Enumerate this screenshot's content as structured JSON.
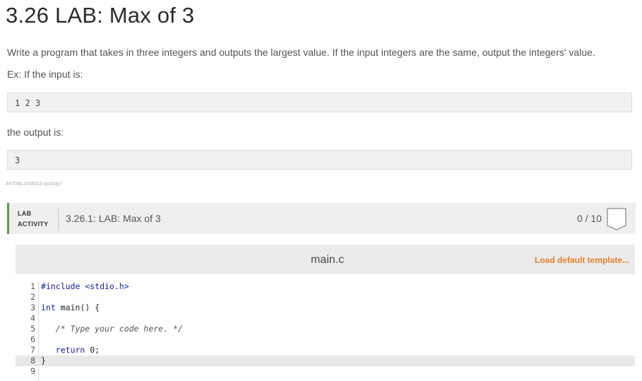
{
  "page": {
    "title": "3.26 LAB: Max of 3",
    "description": "Write a program that takes in three integers and outputs the largest value. If the input integers are the same, output the integers' value.",
    "example_intro": "Ex: If the input is:",
    "example_input": "1 2 3",
    "output_intro": "the output is:",
    "example_output": "3",
    "content_id": "447066.2438310.qx3zqy7"
  },
  "lab": {
    "label_line1": "LAB",
    "label_line2": "ACTIVITY",
    "title": "3.26.1: LAB: Max of 3",
    "score": "0 / 10",
    "accent_color": "#5b9a46"
  },
  "editor": {
    "filename": "main.c",
    "load_template": "Load default template...",
    "lines": [
      {
        "n": "1",
        "segments": [
          {
            "t": "#include <stdio.h>",
            "c": "inc"
          }
        ]
      },
      {
        "n": "2",
        "segments": []
      },
      {
        "n": "3",
        "segments": [
          {
            "t": "int",
            "c": "kw"
          },
          {
            "t": " main() {",
            "c": "plain"
          }
        ]
      },
      {
        "n": "4",
        "segments": []
      },
      {
        "n": "5",
        "segments": [
          {
            "t": "   /* Type your code here. */",
            "c": "cm"
          }
        ]
      },
      {
        "n": "6",
        "segments": []
      },
      {
        "n": "7",
        "segments": [
          {
            "t": "   ",
            "c": "plain"
          },
          {
            "t": "return",
            "c": "kw"
          },
          {
            "t": " 0;",
            "c": "plain"
          }
        ]
      },
      {
        "n": "8",
        "segments": [
          {
            "t": "}",
            "c": "plain"
          }
        ]
      },
      {
        "n": "9",
        "segments": []
      }
    ]
  }
}
